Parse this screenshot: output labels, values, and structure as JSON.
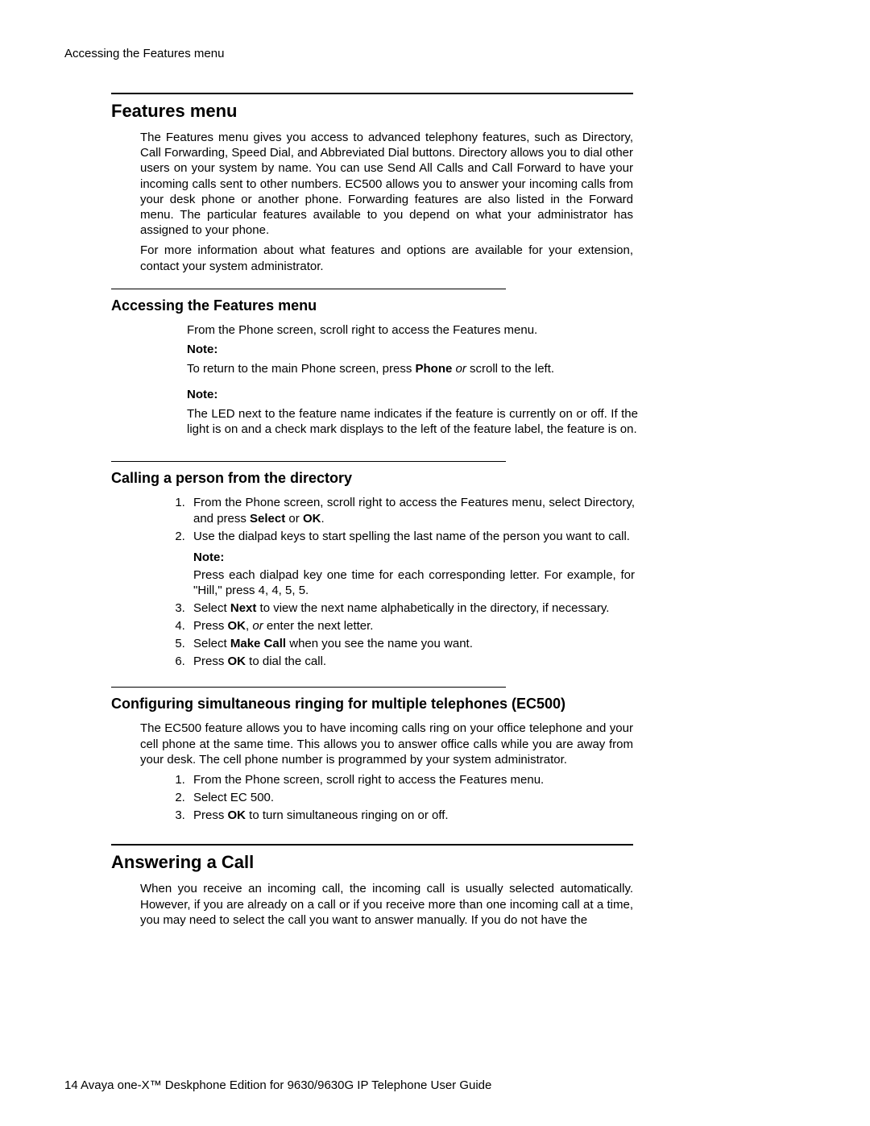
{
  "runningHead": "Accessing the Features menu",
  "sec1": {
    "title": "Features menu",
    "p1": "The Features menu gives you access to advanced telephony features, such as Directory, Call Forwarding, Speed Dial, and Abbreviated Dial buttons. Directory allows you to dial other users on your system by name. You can use Send All Calls and Call Forward to have your incoming calls sent to other numbers. EC500 allows you to answer your incoming calls from your desk phone or another phone. Forwarding features are also listed in the Forward menu. The particular features available to you depend on what your administrator has assigned to your phone.",
    "p2": "For more information about what features and options are available for your extension, contact your system administrator."
  },
  "sub1": {
    "title": "Accessing the Features menu",
    "p1": "From the Phone screen, scroll right to access the Features menu.",
    "noteLabel": "Note:",
    "note1_a": "To return to the main Phone screen, press ",
    "note1_b": "Phone",
    "note1_c": " or ",
    "note1_d": "scroll to the left.",
    "note2Label": "Note:",
    "note2": "The LED next to the feature name indicates if the feature is currently on or off. If the light is on and a check mark displays to the left of the feature label, the feature is on."
  },
  "sub2": {
    "title": "Calling a person from the directory",
    "step1_a": "From the Phone screen, scroll right to access the Features menu, select Directory, and press ",
    "step1_b": "Select",
    "step1_c": " or ",
    "step1_d": "OK",
    "step1_e": ".",
    "step2": "Use the dialpad keys to start spelling the last name of the person you want to call.",
    "noteLabel": "Note:",
    "note": "Press each dialpad key one time for each corresponding letter. For example, for \"Hill,\" press 4, 4, 5, 5.",
    "step3_a": "Select ",
    "step3_b": "Next",
    "step3_c": " to view the next name alphabetically in the directory, if necessary.",
    "step4_a": "Press ",
    "step4_b": "OK",
    "step4_c": ", ",
    "step4_d": "or ",
    "step4_e": "enter the next letter.",
    "step5_a": "Select ",
    "step5_b": "Make Call",
    "step5_c": " when you see the name you want.",
    "step6_a": "Press ",
    "step6_b": "OK",
    "step6_c": " to dial the call."
  },
  "sub3": {
    "title": "Configuring simultaneous ringing for multiple telephones (EC500)",
    "p1": "The EC500 feature allows you to have incoming calls ring on your office telephone and your cell phone at the same time. This allows you to answer office calls while you are away from your desk. The cell phone number is programmed by your system administrator.",
    "step1": "From the Phone screen, scroll right to access the Features menu.",
    "step2": "Select EC 500.",
    "step3_a": "Press ",
    "step3_b": "OK",
    "step3_c": " to turn simultaneous ringing on or off."
  },
  "sec2": {
    "title": "Answering a Call",
    "p1": "When you receive an incoming call, the incoming call is usually selected automatically. However, if you are already on a call or if you receive more than one incoming call at a time, you may need to select the call you want to answer manually. If you do not have the"
  },
  "footer": {
    "pagenum": "14",
    "text": " Avaya one-X™ Deskphone Edition for 9630/9630G IP Telephone User Guide"
  }
}
